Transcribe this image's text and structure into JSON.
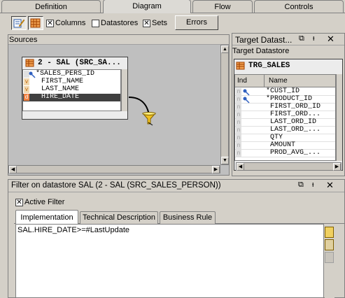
{
  "tabs": [
    {
      "label": "Definition",
      "active": false
    },
    {
      "label": "Diagram",
      "active": true
    },
    {
      "label": "Flow",
      "active": false
    },
    {
      "label": "Controls",
      "active": false
    }
  ],
  "toolbar": {
    "columns_label": "Columns",
    "columns_checked": true,
    "datastores_label": "Datastores",
    "datastores_checked": false,
    "sets_label": "Sets",
    "sets_checked": true,
    "errors_label": "Errors"
  },
  "sources": {
    "title": "Sources",
    "datastore_title": "2 - SAL (SRC_SA...",
    "columns": [
      {
        "name": "*SALES_PERS_ID",
        "selected": false
      },
      {
        "name": "FIRST_NAME",
        "selected": false
      },
      {
        "name": "LAST_NAME",
        "selected": false
      },
      {
        "name": "HIRE_DATE",
        "selected": true
      }
    ]
  },
  "target": {
    "panel_title": "Target Datast...",
    "subtitle": "Target Datastore",
    "datastore_name": "TRG_SALES",
    "col_ind": "Ind",
    "col_name": "Name",
    "rows": [
      "*CUST_ID",
      "*PRODUCT_ID",
      "FIRST_ORD_ID",
      "FIRST_ORD...",
      "LAST_ORD_ID",
      "LAST_ORD_...",
      "QTY",
      "AMOUNT",
      "PROD_AVG_..."
    ]
  },
  "filter": {
    "title": "Filter on datastore SAL (2 - SAL (SRC_SALES_PERSON))",
    "active_label": "Active Filter",
    "active_checked": true,
    "tabs": [
      "Implementation",
      "Technical Description",
      "Business Rule"
    ],
    "expression": "SAL.HIRE_DATE>=#LastUpdate"
  },
  "icons": {
    "restore": "restore-icon",
    "pin": "pin-icon",
    "close": "close-icon"
  }
}
